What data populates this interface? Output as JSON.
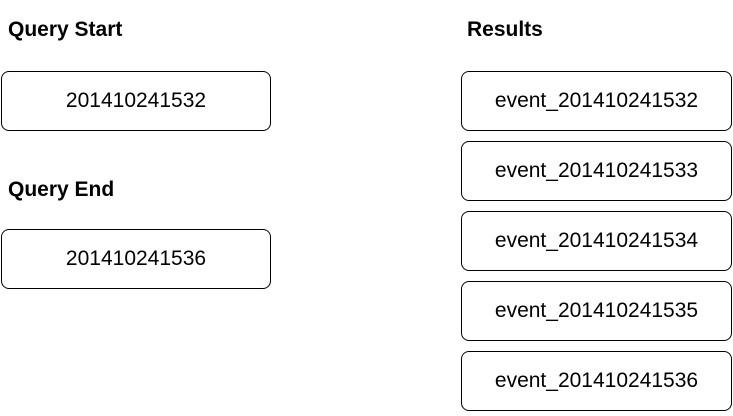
{
  "query_start": {
    "heading": "Query Start",
    "value": "201410241532"
  },
  "query_end": {
    "heading": "Query End",
    "value": "201410241536"
  },
  "results": {
    "heading": "Results",
    "items": [
      "event_201410241532",
      "event_201410241533",
      "event_201410241534",
      "event_201410241535",
      "event_201410241536"
    ]
  },
  "colors": {
    "border": "#000000",
    "background": "#ffffff",
    "text": "#000000"
  }
}
